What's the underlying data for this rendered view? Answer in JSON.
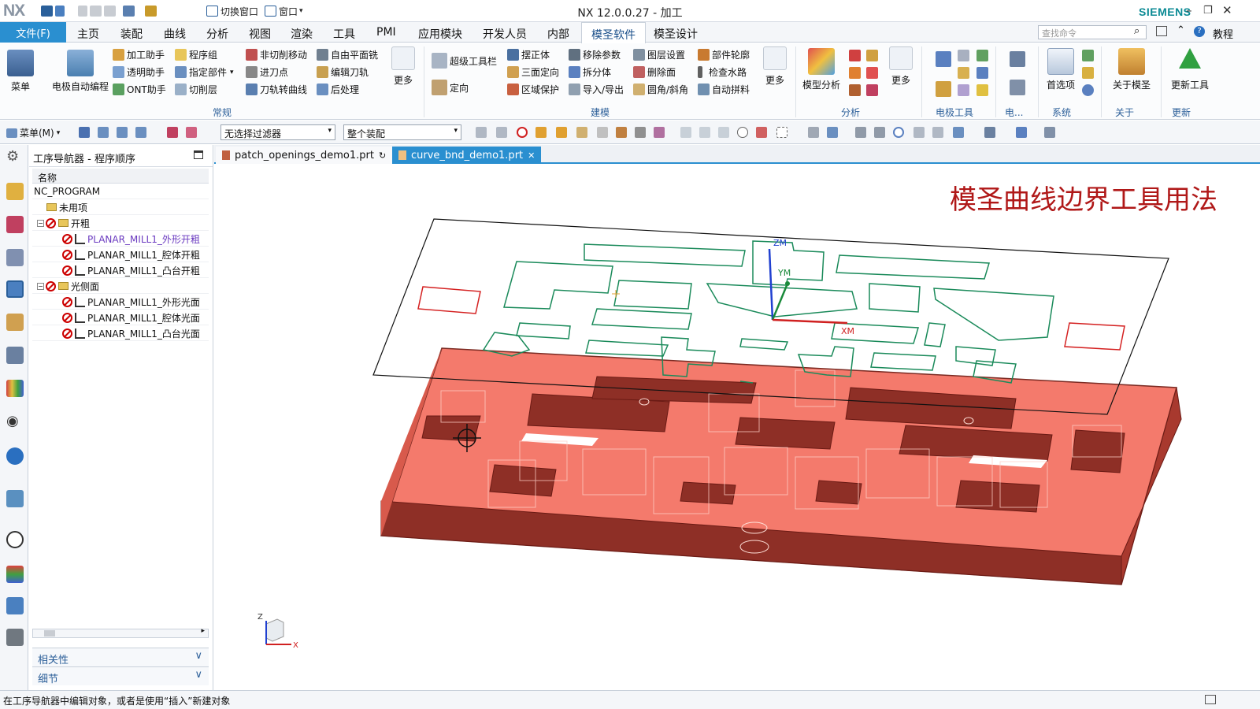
{
  "app": {
    "logo": "NX",
    "window_title": "NX 12.0.0.27 - 加工",
    "brand": "SIEMENS",
    "quick_access": {
      "switch_window": "切换窗口",
      "window": "窗口"
    }
  },
  "menubar": {
    "file": "文件(F)",
    "tabs": [
      "主页",
      "装配",
      "曲线",
      "分析",
      "视图",
      "渲染",
      "工具",
      "PMI",
      "应用模块",
      "开发人员",
      "内部",
      "模圣软件",
      "模圣设计"
    ],
    "active_tab": "模圣软件",
    "search_placeholder": "查找命令",
    "help": "教程"
  },
  "ribbon": {
    "menu": "菜单",
    "electrode_auto": "电极自动编程",
    "col1": [
      "加工助手",
      "透明助手",
      "ONT助手"
    ],
    "col2": [
      "程序组",
      "指定部件",
      "切削层"
    ],
    "col3": [
      "非切削移动",
      "进刀点",
      "刀轨转曲线"
    ],
    "col4": [
      "自由平面铣",
      "编辑刀轨",
      "后处理"
    ],
    "more1": "更多",
    "super_toolbar": "超级工具栏",
    "orient": "定向",
    "col5": [
      "摆正体",
      "三面定向",
      "区域保护"
    ],
    "col6": [
      "移除参数",
      "拆分体",
      "导入/导出"
    ],
    "col7": [
      "图层设置",
      "删除面",
      "圆角/斜角"
    ],
    "col8": [
      "部件轮廓",
      "检查水路",
      "自动拼料"
    ],
    "more2": "更多",
    "model_analysis": "模型分析",
    "more3": "更多",
    "preferences": "首选项",
    "about": "关于模圣",
    "update_tool": "更新工具",
    "groups": [
      "常规",
      "建模",
      "分析",
      "电极工具",
      "电...",
      "系统",
      "关于",
      "更新"
    ]
  },
  "cmdbar": {
    "menu": "菜单(M)",
    "filter": "无选择过滤器",
    "scope": "整个装配"
  },
  "navigator": {
    "title": "工序导航器 - 程序顺序",
    "column": "名称",
    "root": "NC_PROGRAM",
    "unused": "未用项",
    "groups": [
      {
        "name": "开粗",
        "ops": [
          "PLANAR_MILL1_外形开粗",
          "PLANAR_MILL1_腔体开粗",
          "PLANAR_MILL1_凸台开粗"
        ]
      },
      {
        "name": "光侧面",
        "ops": [
          "PLANAR_MILL1_外形光面",
          "PLANAR_MILL1_腔体光面",
          "PLANAR_MILL1_凸台光面"
        ]
      }
    ],
    "panels": [
      "相关性",
      "细节"
    ]
  },
  "file_tabs": [
    "patch_openings_demo1.prt",
    "curve_bnd_demo1.prt"
  ],
  "viewport": {
    "heading": "模圣曲线边界工具用法",
    "axes": {
      "zm": "ZM",
      "ym": "YM",
      "xm": "XM",
      "z": "Z",
      "x": "X"
    }
  },
  "status": "在工序导航器中编辑对象，或者是使用“插入”新建对象",
  "colors": {
    "accent": "#2a8fd0",
    "part": "#f07060",
    "part_dark": "#8a2a22",
    "curve_green": "#1a8a5a",
    "curve_red": "#d42020",
    "heading": "#b01818"
  }
}
